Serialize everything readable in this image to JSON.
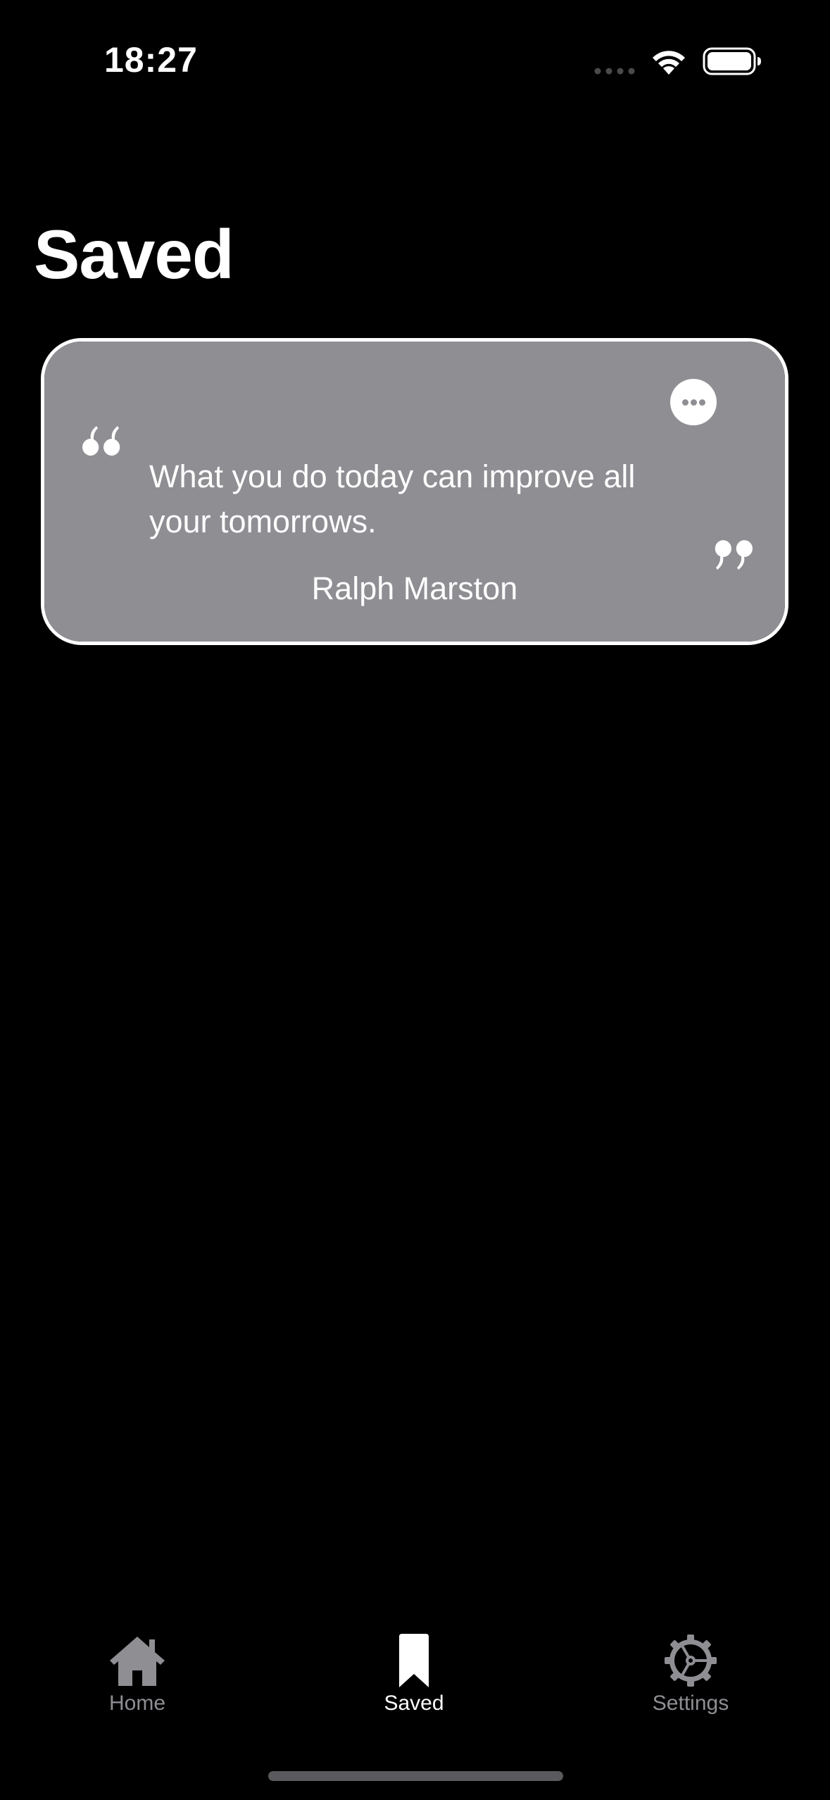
{
  "status_bar": {
    "time": "18:27"
  },
  "page": {
    "title": "Saved"
  },
  "quote_card": {
    "text": "What you do today can improve all your tomorrows.",
    "author": "Ralph Marston",
    "background_color": "#8e8e93",
    "border_color": "#ffffff",
    "more_icon": "ellipsis-circle-icon",
    "open_quote_icon": "open-quote-icon",
    "close_quote_icon": "close-quote-icon"
  },
  "tab_bar": {
    "active_color": "#ffffff",
    "inactive_color": "#8e8e93",
    "items": [
      {
        "label": "Home",
        "icon": "house-icon",
        "active": false
      },
      {
        "label": "Saved",
        "icon": "bookmark-icon",
        "active": true
      },
      {
        "label": "Settings",
        "icon": "gear-icon",
        "active": false
      }
    ]
  }
}
